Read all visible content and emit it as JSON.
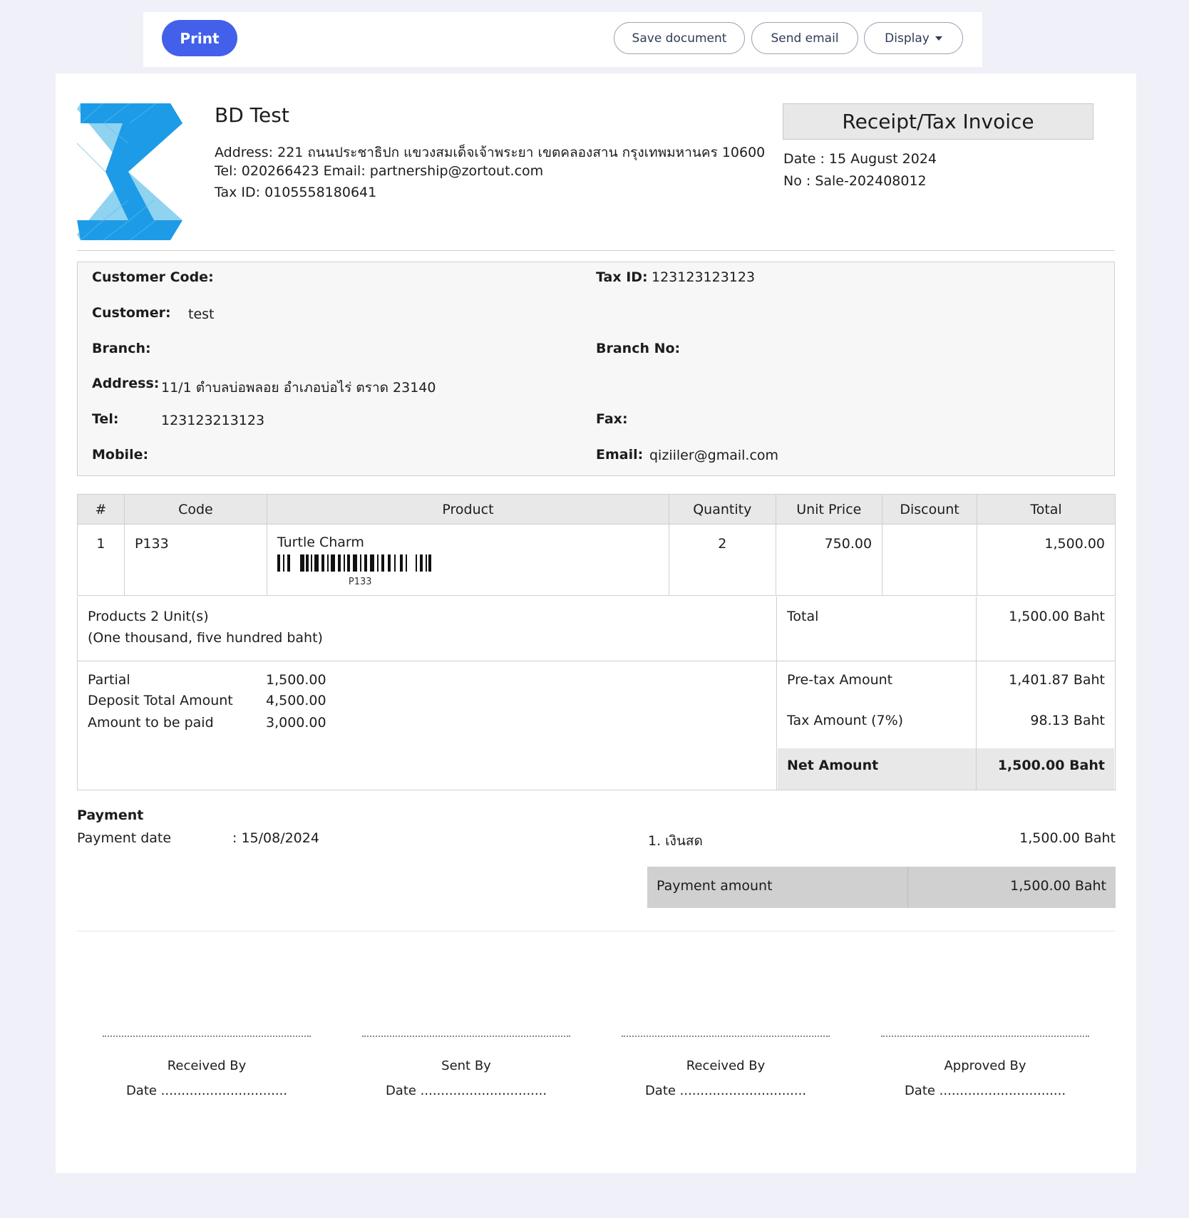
{
  "toolbar": {
    "print_label": "Print",
    "save_label": "Save document",
    "email_label": "Send email",
    "display_label": "Display"
  },
  "company": {
    "name": "BD Test",
    "address": "Address: 221 ถนนประชาธิปก แขวงสมเด็จเจ้าพระยา เขตคลองสาน กรุงเทพมหานคร 10600",
    "contact": "Tel: 020266423 Email: partnership@zortout.com",
    "tax_id": "Tax ID: 0105558180641"
  },
  "document": {
    "title": "Receipt/Tax Invoice",
    "date": "Date : 15 August 2024",
    "number": "No : Sale-202408012"
  },
  "customer": {
    "code_label": "Customer Code:",
    "code_value": "",
    "tax_label": "Tax ID:",
    "tax_value": "123123123123",
    "name_label": "Customer:",
    "name_value": "test",
    "branch_label": "Branch:",
    "branch_value": "",
    "branch_no_label": "Branch No:",
    "branch_no_value": "",
    "address_label": "Address:",
    "address_value": "11/1 ตำบลบ่อพลอย อำเภอบ่อไร่ ตราด 23140",
    "tel_label": "Tel:",
    "tel_value": "123123213123",
    "fax_label": "Fax:",
    "fax_value": "",
    "mobile_label": "Mobile:",
    "mobile_value": "",
    "email_label": "Email:",
    "email_value": "qiziiler@gmail.com"
  },
  "items": {
    "headers": [
      "#",
      "Code",
      "Product",
      "Quantity",
      "Unit Price",
      "Discount",
      "Total"
    ],
    "rows": [
      {
        "no": "1",
        "code": "P133",
        "product": "Turtle Charm",
        "barcode": "P133",
        "quantity": "2",
        "unit_price": "750.00",
        "discount": "",
        "total": "1,500.00"
      }
    ]
  },
  "summary": {
    "units": "Products 2 Unit(s)",
    "words": "(One thousand, five hundred baht)",
    "total_label": "Total",
    "total_value": "1,500.00 Baht",
    "partial_label": "Partial",
    "partial_value": "1,500.00",
    "deposit_label": "Deposit Total Amount",
    "deposit_value": "4,500.00",
    "topay_label": "Amount to be paid",
    "topay_value": "3,000.00",
    "pretax_label": "Pre-tax Amount",
    "pretax_value": "1,401.87 Baht",
    "tax_label": "Tax Amount (7%)",
    "tax_value": "98.13 Baht",
    "net_label": "Net Amount",
    "net_value": "1,500.00 Baht"
  },
  "payment": {
    "title": "Payment",
    "date_label": "Payment date",
    "date_value": ": 15/08/2024",
    "method": "1. เงินสด",
    "method_amount": "1,500.00 Baht",
    "amount_label": "Payment amount",
    "amount_value": "1,500.00 Baht"
  },
  "signatures": [
    {
      "title": "Received By",
      "date": "Date ..............................."
    },
    {
      "title": "Sent By",
      "date": "Date ..............................."
    },
    {
      "title": "Received By",
      "date": "Date ..............................."
    },
    {
      "title": "Approved By",
      "date": "Date ..............................."
    }
  ],
  "colors": {
    "primary_button": "#4360ea",
    "logo_dark": "#1e9be6",
    "logo_light": "#8fd3f0"
  }
}
